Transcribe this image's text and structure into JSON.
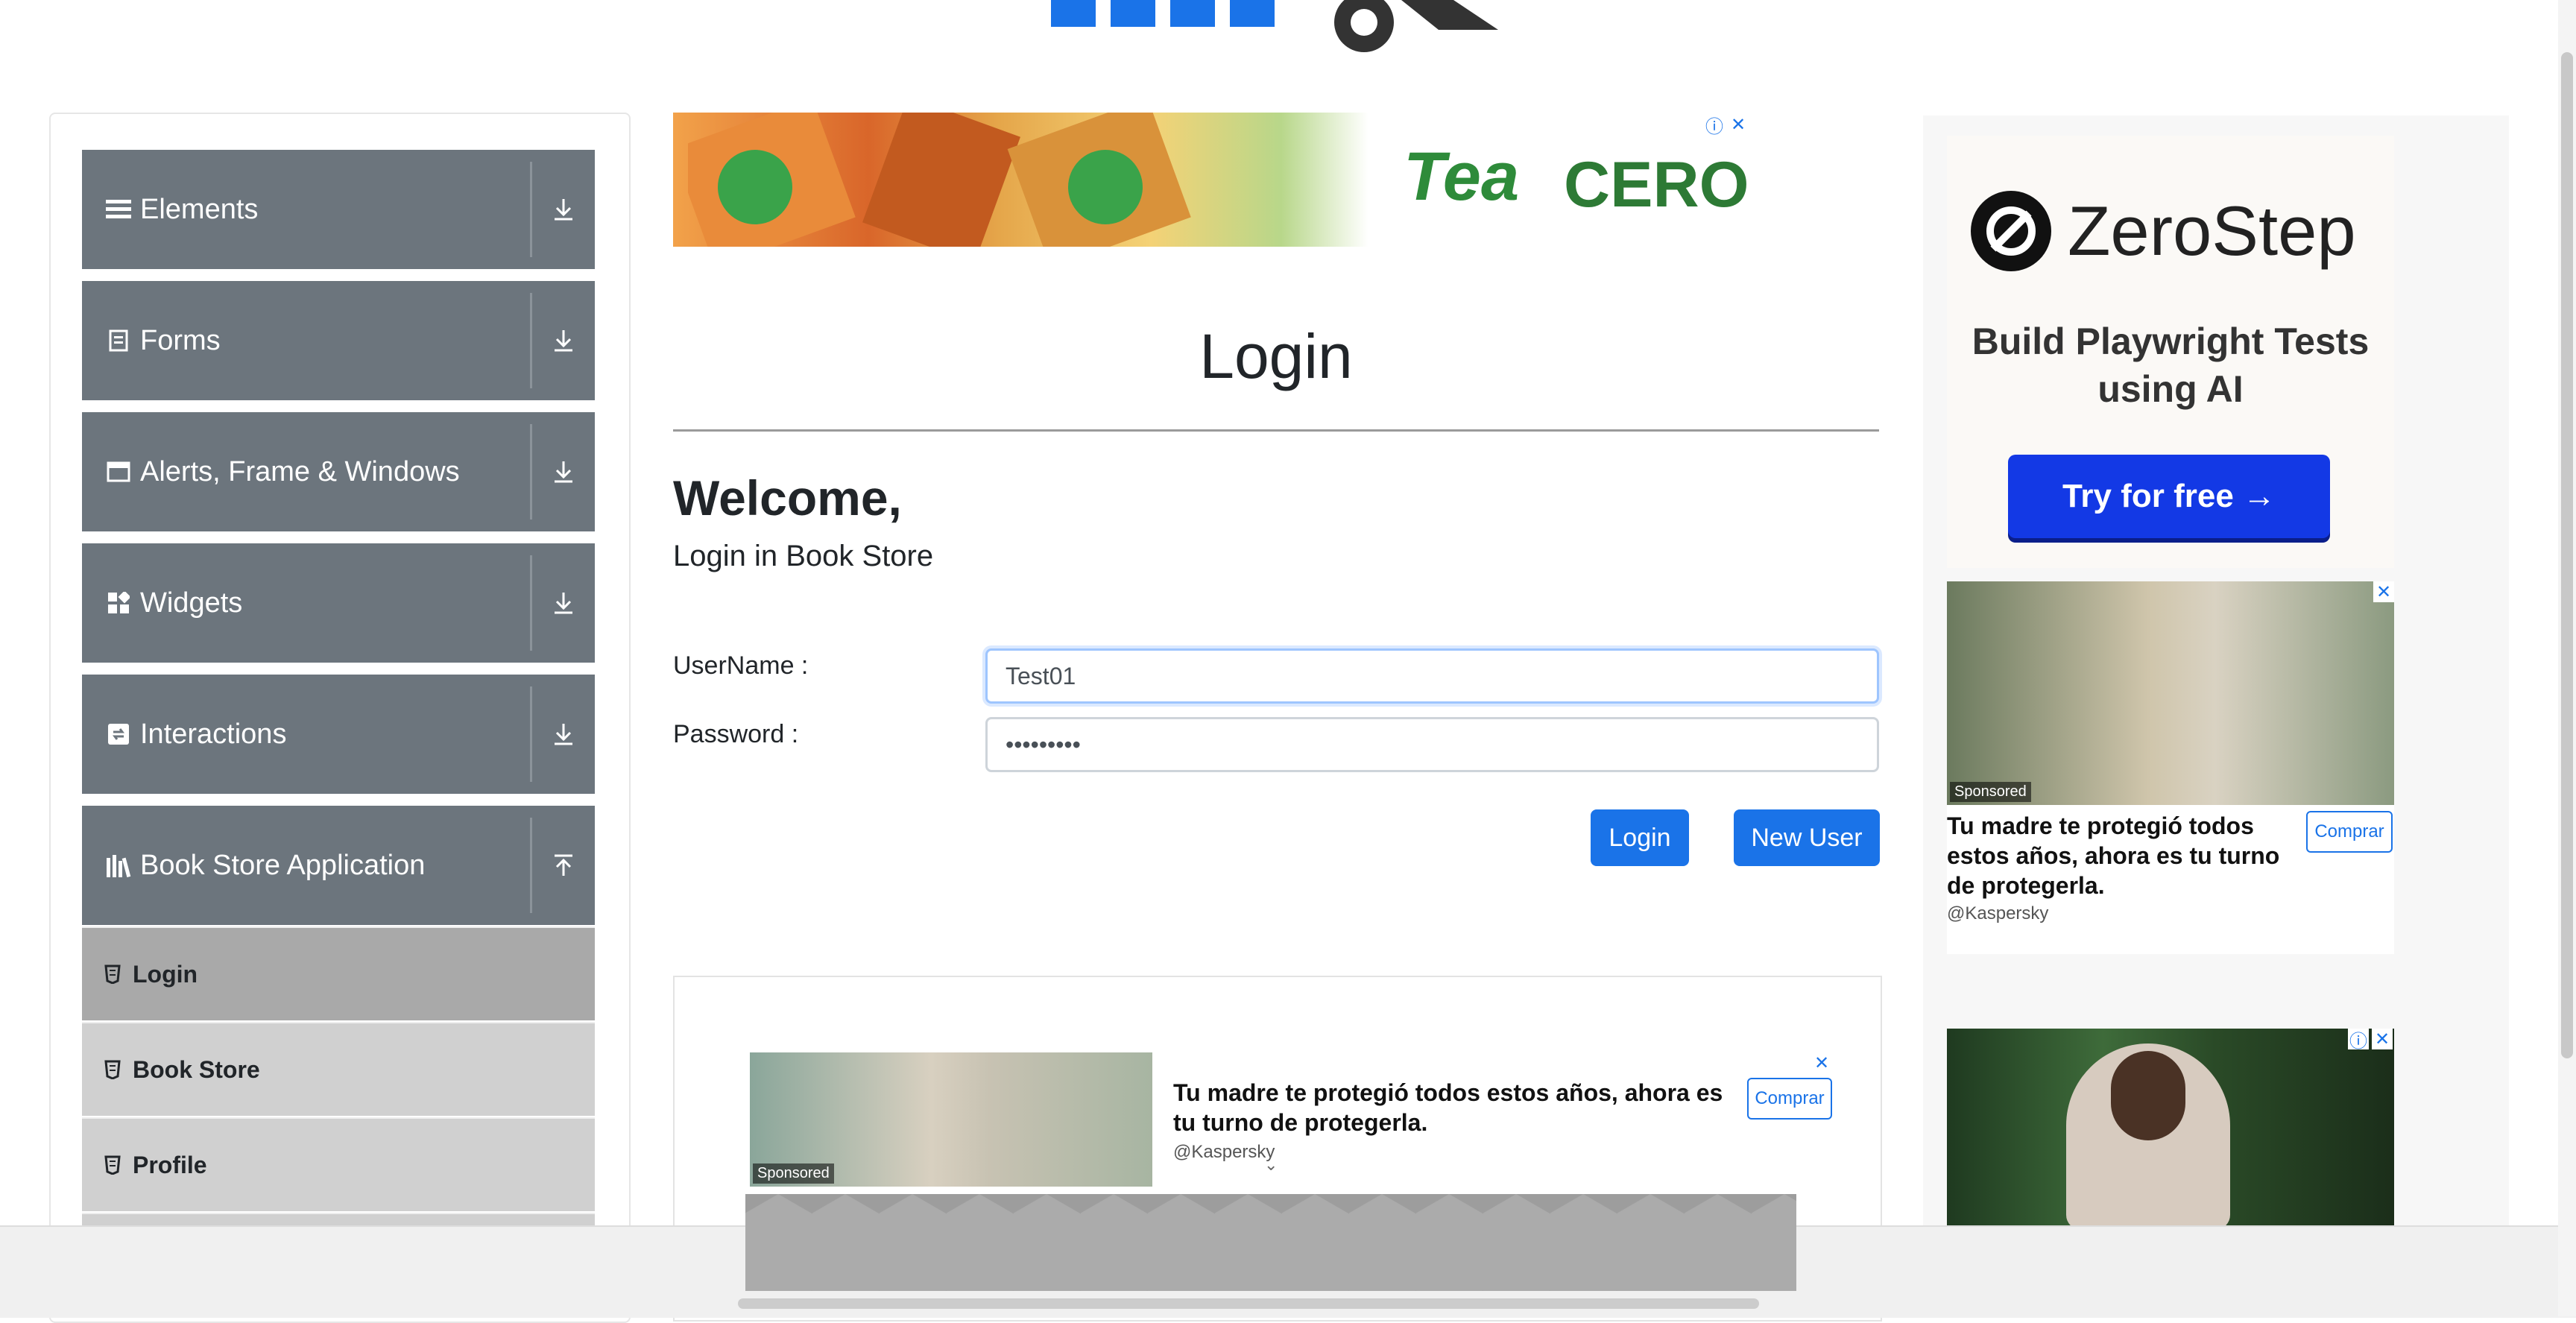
{
  "sidebar": {
    "groups": [
      {
        "label": "Elements",
        "icon": "list-icon",
        "expanded": false
      },
      {
        "label": "Forms",
        "icon": "form-icon",
        "expanded": false
      },
      {
        "label": "Alerts, Frame & Windows",
        "icon": "window-icon",
        "expanded": false
      },
      {
        "label": "Widgets",
        "icon": "widgets-icon",
        "expanded": false
      },
      {
        "label": "Interactions",
        "icon": "interactions-icon",
        "expanded": false
      },
      {
        "label": "Book Store Application",
        "icon": "books-icon",
        "expanded": true
      }
    ],
    "book_store_items": [
      {
        "label": "Login",
        "active": true
      },
      {
        "label": "Book Store",
        "active": false
      },
      {
        "label": "Profile",
        "active": false
      }
    ]
  },
  "top_ad": {
    "brand": "Tea",
    "label": "CERO"
  },
  "main": {
    "heading": "Login",
    "welcome": "Welcome,",
    "subtitle": "Login in Book Store",
    "username_label": "UserName :",
    "username_value": "Test01",
    "password_label": "Password :",
    "password_value": "•••••••••",
    "login_button": "Login",
    "new_user_button": "New User"
  },
  "bottom_ad": {
    "sponsored": "Sponsored",
    "text": "Tu madre te protegió todos estos años, ahora es tu turno de protegerla.",
    "source": "@Kaspersky",
    "cta": "Comprar"
  },
  "right_ads": {
    "zerostep": {
      "brand": "ZeroStep",
      "tagline": "Build Playwright Tests using AI",
      "cta": "Try for free →"
    },
    "kaspersky": {
      "sponsored": "Sponsored",
      "text": "Tu madre te protegió todos estos años, ahora es tu turno de protegerla.",
      "source": "@Kaspersky",
      "cta": "Comprar"
    }
  },
  "colors": {
    "sidebar_group": "#6c757d",
    "primary_button": "#1a73e8",
    "active_item": "#a9a9a9"
  }
}
